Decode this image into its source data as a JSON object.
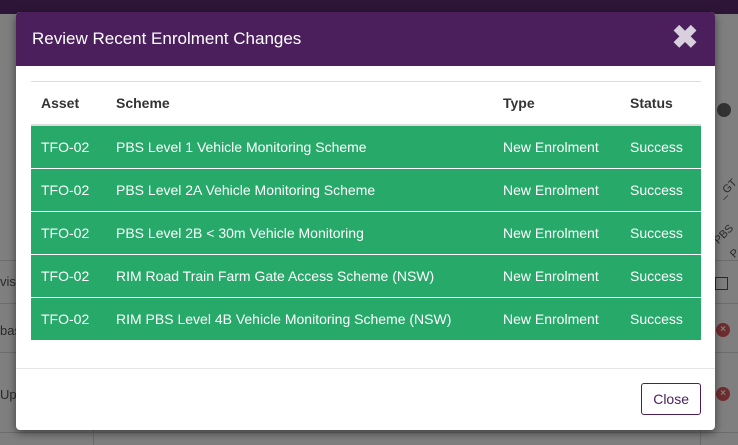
{
  "modal": {
    "title": "Review Recent Enrolment Changes",
    "close_icon": "close-icon",
    "close_button_label": "Close",
    "row_color": "#27a96a",
    "header_color": "#4a1f5c"
  },
  "table": {
    "headers": {
      "asset": "Asset",
      "scheme": "Scheme",
      "type": "Type",
      "status": "Status"
    },
    "rows": [
      {
        "asset": "TFO-02",
        "scheme": "PBS Level 1 Vehicle Monitoring Scheme",
        "type": "New Enrolment",
        "status": "Success"
      },
      {
        "asset": "TFO-02",
        "scheme": "PBS Level 2A Vehicle Monitoring Scheme",
        "type": "New Enrolment",
        "status": "Success"
      },
      {
        "asset": "TFO-02",
        "scheme": "PBS Level 2B < 30m Vehicle Monitoring",
        "type": "New Enrolment",
        "status": "Success"
      },
      {
        "asset": "TFO-02",
        "scheme": "RIM Road Train Farm Gate Access Scheme (NSW)",
        "type": "New Enrolment",
        "status": "Success"
      },
      {
        "asset": "TFO-02",
        "scheme": "RIM PBS Level 4B Vehicle Monitoring Scheme (NSW)",
        "type": "New Enrolment",
        "status": "Success"
      }
    ]
  },
  "background": {
    "fragments": {
      "visi": "visi",
      "bas": "bas",
      "upg": "Upg",
      "gt": "_GT",
      "pbs": "PBS",
      "p": "P"
    }
  }
}
